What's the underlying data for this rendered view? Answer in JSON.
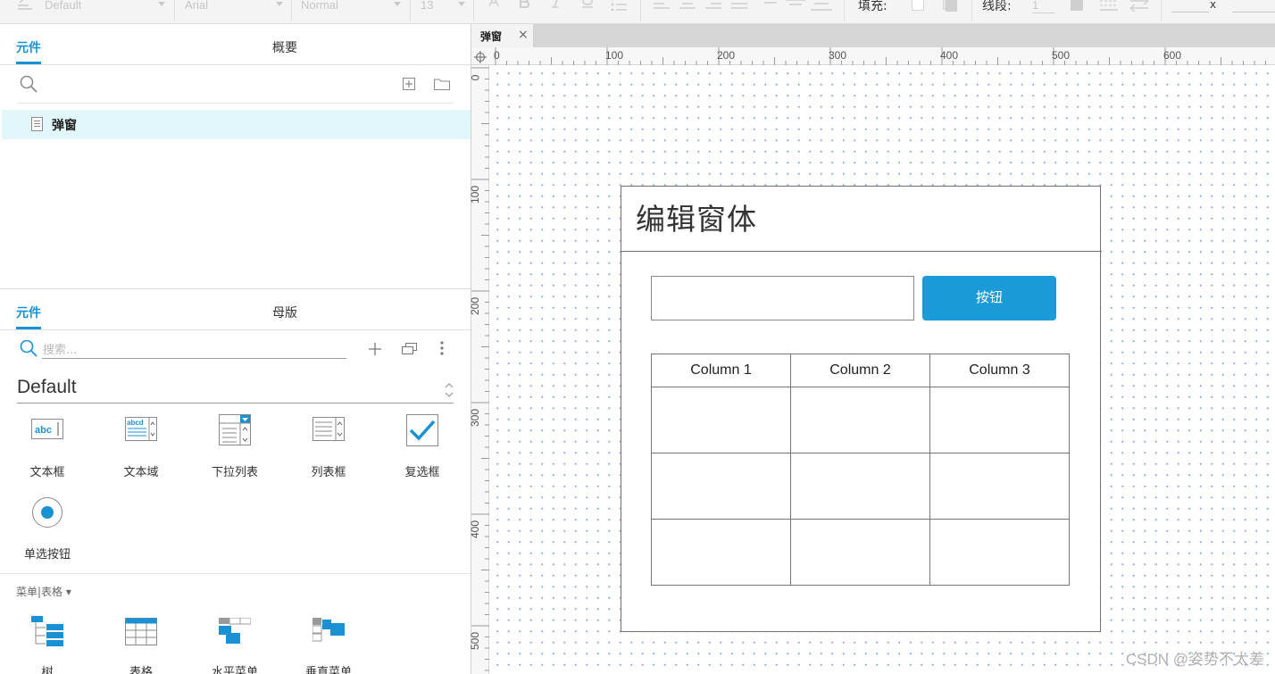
{
  "toolbar": {
    "style_select": "Default",
    "font_select": "Arial",
    "weight_select": "Normal",
    "size_select": "13",
    "fill_label": "填充:",
    "stroke_label": "线段:",
    "stroke_value": "1",
    "x_label": "x"
  },
  "outline_panel": {
    "tabs": [
      {
        "label": "元件",
        "active": true
      },
      {
        "label": "概要",
        "active": false
      }
    ],
    "pages": [
      {
        "label": "弹窗",
        "selected": true
      }
    ]
  },
  "library_panel": {
    "tabs": [
      {
        "label": "元件",
        "active": true
      },
      {
        "label": "母版",
        "active": false
      }
    ],
    "search_placeholder": "搜索...",
    "library_name": "Default",
    "widgets": [
      {
        "label": "文本框",
        "icon": "text-box-icon"
      },
      {
        "label": "文本域",
        "icon": "text-area-icon"
      },
      {
        "label": "下拉列表",
        "icon": "dropdown-list-icon"
      },
      {
        "label": "列表框",
        "icon": "list-box-icon"
      },
      {
        "label": "复选框",
        "icon": "checkbox-icon"
      },
      {
        "label": "单选按钮",
        "icon": "radio-button-icon"
      }
    ],
    "section": "菜单|表格 ▾",
    "menu_widgets": [
      {
        "label": "树",
        "icon": "tree-icon"
      },
      {
        "label": "表格",
        "icon": "table-icon"
      },
      {
        "label": "水平菜单",
        "icon": "horizontal-menu-icon"
      },
      {
        "label": "垂直菜单",
        "icon": "vertical-menu-icon"
      }
    ]
  },
  "document_tab": {
    "label": "弹窗",
    "close": "×"
  },
  "ruler": {
    "horizontal": [
      "0",
      "100",
      "200",
      "300",
      "400",
      "500",
      "600"
    ],
    "vertical": [
      "0",
      "100",
      "200",
      "300",
      "400",
      "500"
    ]
  },
  "canvas": {
    "dialog_title": "编辑窗体",
    "button_label": "按钮",
    "table_columns": [
      "Column 1",
      "Column 2",
      "Column 3"
    ],
    "table_rows": [
      [
        "",
        "",
        ""
      ],
      [
        "",
        "",
        ""
      ],
      [
        "",
        "",
        ""
      ]
    ]
  },
  "watermark": "CSDN @姿势不太差",
  "colors": {
    "accent": "#1a91d4",
    "button": "#1a9ad6",
    "selected_row": "#e1f7f9",
    "grid_dot": "#8ea6d8"
  }
}
